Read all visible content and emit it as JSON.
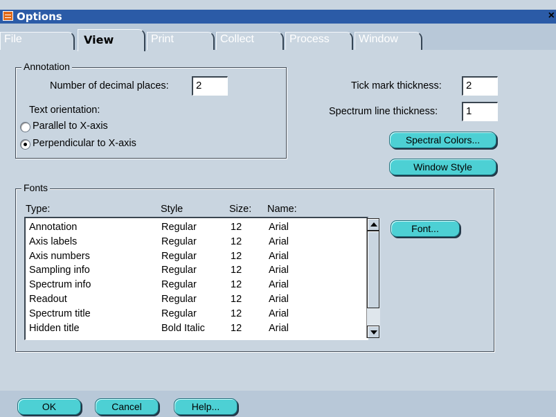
{
  "window": {
    "title": "Options",
    "close_label": "×"
  },
  "tabs": [
    {
      "label": "File"
    },
    {
      "label": "View"
    },
    {
      "label": "Print"
    },
    {
      "label": "Collect"
    },
    {
      "label": "Process"
    },
    {
      "label": "Window"
    }
  ],
  "annotation": {
    "legend": "Annotation",
    "decimal_label": "Number of decimal places:",
    "decimal_value": "2",
    "orientation_label": "Text orientation:",
    "option_parallel": "Parallel to X-axis",
    "option_perpendicular": "Perpendicular to X-axis",
    "selected": "perpendicular"
  },
  "thickness": {
    "tick_label": "Tick mark thickness:",
    "tick_value": "2",
    "spectrum_label": "Spectrum line thickness:",
    "spectrum_value": "1"
  },
  "buttons": {
    "spectral_colors": "Spectral Colors...",
    "window_style": "Window Style",
    "font": "Font...",
    "ok": "OK",
    "cancel": "Cancel",
    "help": "Help..."
  },
  "fonts": {
    "legend": "Fonts",
    "headers": {
      "type": "Type:",
      "style": "Style",
      "size": "Size:",
      "name": "Name:"
    },
    "rows": [
      {
        "type": "Annotation",
        "style": "Regular",
        "size": "12",
        "name": "Arial"
      },
      {
        "type": "Axis labels",
        "style": "Regular",
        "size": "12",
        "name": "Arial"
      },
      {
        "type": "Axis numbers",
        "style": "Regular",
        "size": "12",
        "name": "Arial"
      },
      {
        "type": "Sampling info",
        "style": "Regular",
        "size": "12",
        "name": "Arial"
      },
      {
        "type": "Spectrum info",
        "style": "Regular",
        "size": "12",
        "name": "Arial"
      },
      {
        "type": "Readout",
        "style": "Regular",
        "size": "12",
        "name": "Arial"
      },
      {
        "type": "Spectrum title",
        "style": "Regular",
        "size": "12",
        "name": "Arial"
      },
      {
        "type": "Hidden title",
        "style": "Bold Italic",
        "size": "12",
        "name": "Arial"
      }
    ]
  },
  "colors": {
    "titlebar": "#2b5ba7",
    "panel": "#c9d5e0",
    "button": "#4dd0d4"
  }
}
